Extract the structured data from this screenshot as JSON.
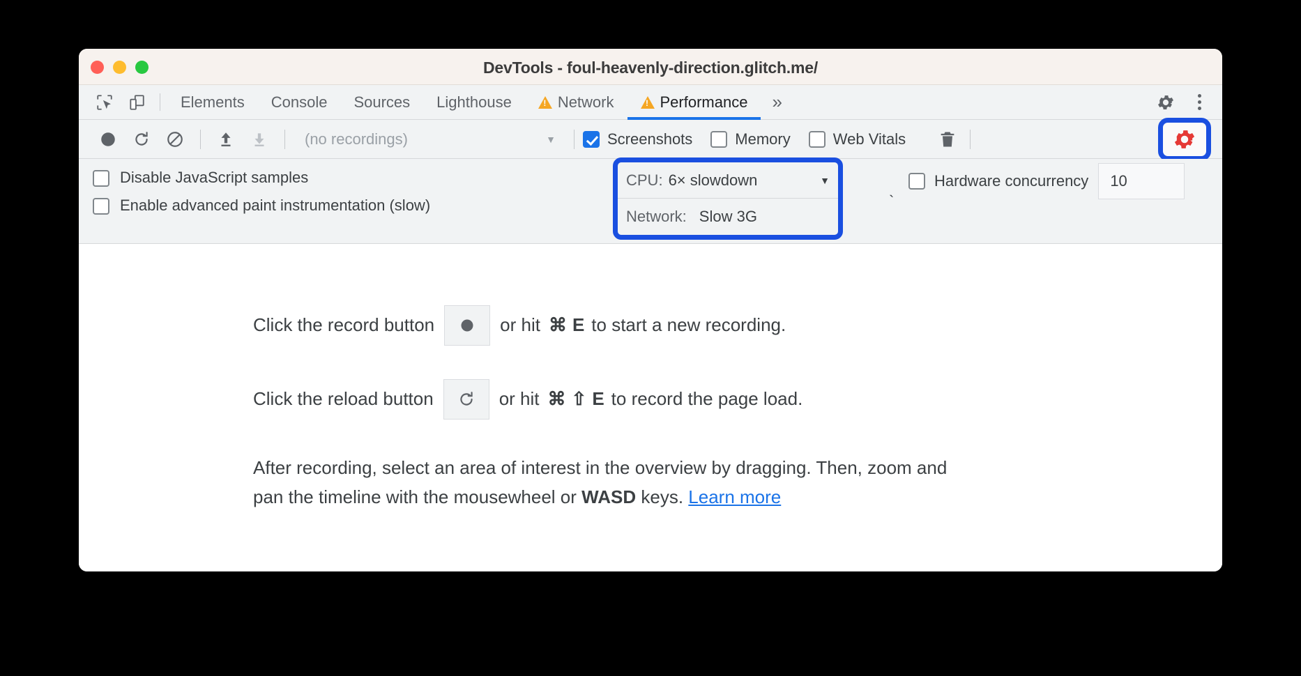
{
  "window": {
    "title": "DevTools - foul-heavenly-direction.glitch.me/",
    "traffic_lights": [
      "close",
      "minimize",
      "maximize"
    ]
  },
  "tabstrip": {
    "left_icons": [
      {
        "name": "inspect-element-icon",
        "label": "Inspect element"
      },
      {
        "name": "device-toolbar-icon",
        "label": "Toggle device toolbar"
      }
    ],
    "tabs": [
      {
        "label": "Elements",
        "active": false,
        "warning": false
      },
      {
        "label": "Console",
        "active": false,
        "warning": false
      },
      {
        "label": "Sources",
        "active": false,
        "warning": false
      },
      {
        "label": "Lighthouse",
        "active": false,
        "warning": false
      },
      {
        "label": "Network",
        "active": false,
        "warning": true
      },
      {
        "label": "Performance",
        "active": true,
        "warning": true
      }
    ],
    "overflow_label": "»",
    "right_icons": [
      {
        "name": "settings-gear-icon",
        "label": "Settings"
      },
      {
        "name": "more-options-kebab-icon",
        "label": "Customize and control DevTools"
      }
    ]
  },
  "perf_toolbar": {
    "record_label": "Record",
    "reload_label": "Start profiling and reload page",
    "clear_label": "Clear",
    "load_label": "Load profile",
    "save_label": "Save profile",
    "recordings_value": "(no recordings)",
    "recordings_arrow": "▼",
    "checkboxes": [
      {
        "label": "Screenshots",
        "checked": true
      },
      {
        "label": "Memory",
        "checked": false
      },
      {
        "label": "Web Vitals",
        "checked": false
      }
    ],
    "trash_label": "Clear recording",
    "capture_settings_label": "Capture settings",
    "highlight_color": "#1a4fe0",
    "gear_color": "#e53935"
  },
  "settings_pane": {
    "left_checkboxes": [
      {
        "label": "Disable JavaScript samples",
        "checked": false
      },
      {
        "label": "Enable advanced paint instrumentation (slow)",
        "checked": false
      }
    ],
    "throttling": {
      "cpu_label": "CPU:",
      "cpu_value": "6× slowdown",
      "cpu_arrow": "▼",
      "network_label": "Network:",
      "network_value": "Slow 3G"
    },
    "hardware_concurrency": {
      "label": "Hardware concurrency",
      "checked": false,
      "value": "10"
    },
    "stray_tick": "`"
  },
  "main": {
    "line1": {
      "prefix": "Click the record button",
      "icon": "record-circle-icon",
      "mid": "or hit",
      "key1": "⌘",
      "key2": "E",
      "suffix": "to start a new recording."
    },
    "line2": {
      "prefix": "Click the reload button",
      "icon": "reload-icon",
      "mid": "or hit",
      "key1": "⌘",
      "key2": "⇧",
      "key3": "E",
      "suffix": "to record the page load."
    },
    "paragraph": {
      "part1": "After recording, select an area of interest in the overview by dragging. Then, zoom and pan the timeline with the mousewheel or ",
      "bold": "WASD",
      "part2": " keys. ",
      "link": "Learn more"
    }
  }
}
